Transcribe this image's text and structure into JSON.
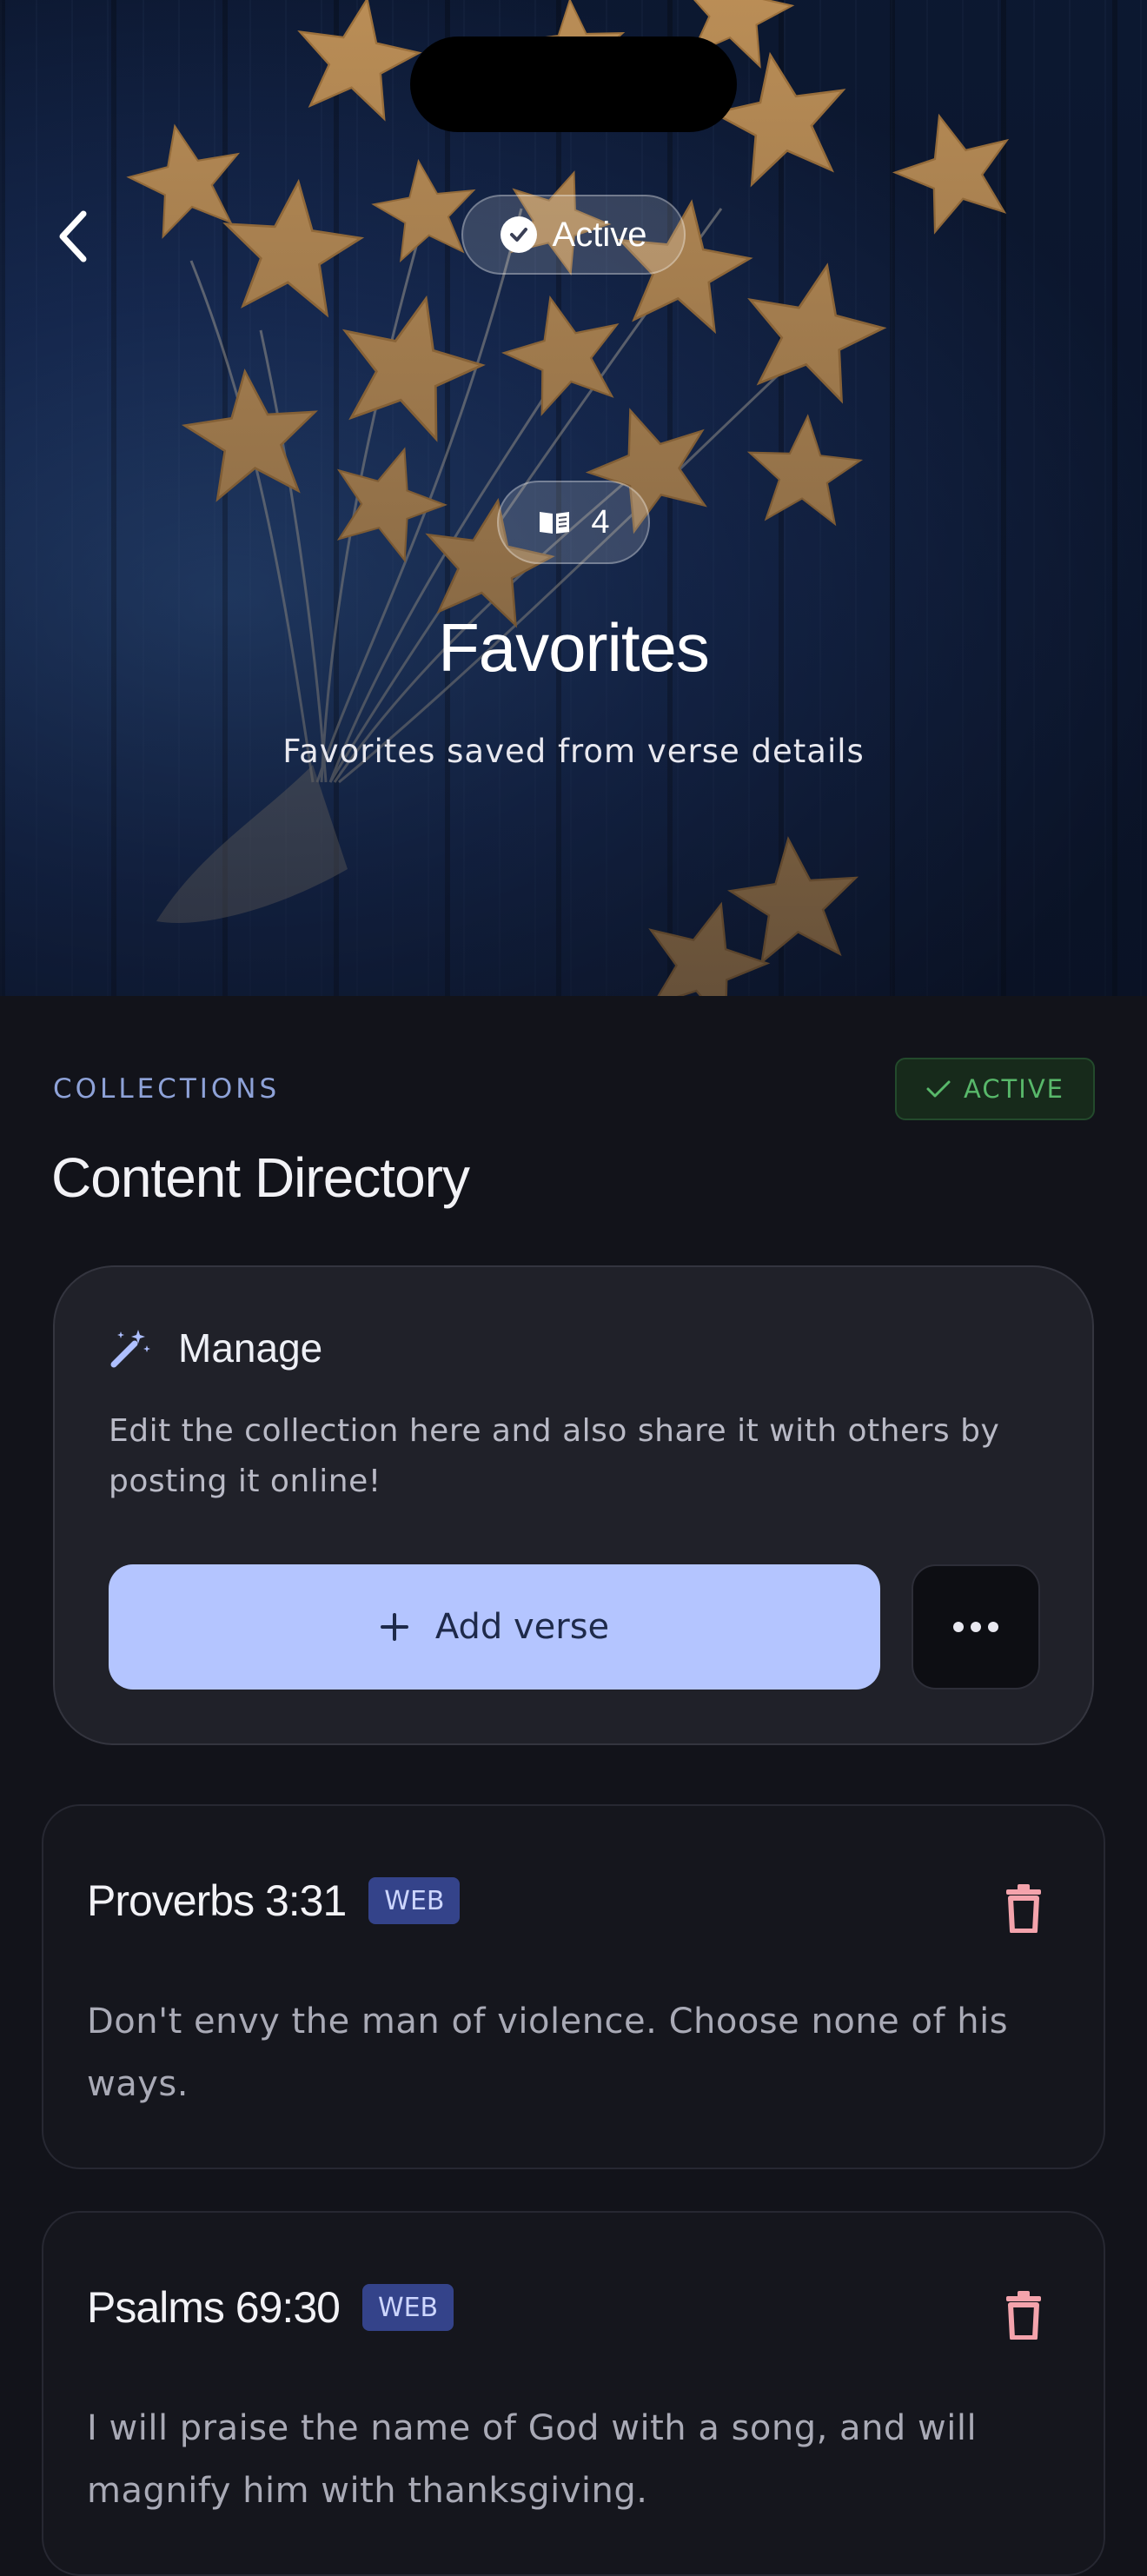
{
  "hero": {
    "status_label": "Active",
    "verse_count": "4",
    "title": "Favorites",
    "subtitle": "Favorites saved from verse details",
    "icons": {
      "back": "chevron-left-icon",
      "status": "check-circle-icon",
      "count": "book-open-icon"
    }
  },
  "section": {
    "label": "COLLECTIONS",
    "badge": "ACTIVE",
    "title": "Content Directory"
  },
  "manage": {
    "title": "Manage",
    "description": "Edit the collection here and also share it with others by posting it online!",
    "add_label": "Add verse",
    "icons": {
      "header": "magic-wand-icon",
      "add": "plus-icon",
      "more": "more-horizontal-icon"
    }
  },
  "verses": [
    {
      "reference": "Proverbs 3:31",
      "version": "WEB",
      "text": "Don't envy the man of violence. Choose none of his ways."
    },
    {
      "reference": "Psalms 69:30",
      "version": "WEB",
      "text": "I will praise the name of God with a song, and will magnify him with thanksgiving."
    }
  ],
  "colors": {
    "background": "#12131a",
    "accent": "#b4c5ff",
    "active_green": "#58b86a",
    "delete_red": "#f4a3ac",
    "version_badge": "#34438a"
  }
}
